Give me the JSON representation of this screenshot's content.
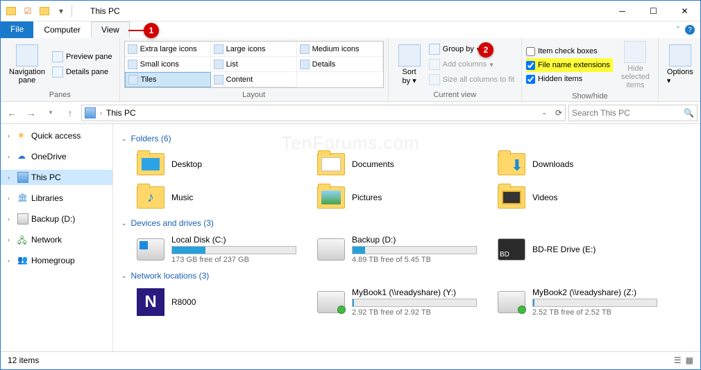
{
  "title": "This PC",
  "tabs": {
    "file": "File",
    "computer": "Computer",
    "view": "View"
  },
  "ribbon": {
    "panes": {
      "nav": "Navigation\npane",
      "preview": "Preview pane",
      "details": "Details pane",
      "group": "Panes"
    },
    "layout": {
      "extra_large": "Extra large icons",
      "large": "Large icons",
      "medium": "Medium icons",
      "small": "Small icons",
      "list": "List",
      "details": "Details",
      "tiles": "Tiles",
      "content": "Content",
      "group": "Layout"
    },
    "current": {
      "sort": "Sort\nby",
      "groupby": "Group by",
      "addcols": "Add columns",
      "sizeall": "Size all columns to fit",
      "group": "Current view"
    },
    "showhide": {
      "itemcheck": "Item check boxes",
      "fileext": "File name extensions",
      "hidden": "Hidden items",
      "hidesel": "Hide selected\nitems",
      "group": "Show/hide"
    },
    "options": "Options"
  },
  "address": {
    "path": "This PC",
    "search_placeholder": "Search This PC"
  },
  "nav": {
    "quick": "Quick access",
    "onedrive": "OneDrive",
    "thispc": "This PC",
    "libraries": "Libraries",
    "backup": "Backup (D:)",
    "network": "Network",
    "homegroup": "Homegroup"
  },
  "sections": {
    "folders": "Folders (6)",
    "drives": "Devices and drives (3)",
    "netloc": "Network locations (3)"
  },
  "folders": {
    "desktop": "Desktop",
    "documents": "Documents",
    "downloads": "Downloads",
    "music": "Music",
    "pictures": "Pictures",
    "videos": "Videos"
  },
  "drives": {
    "local": {
      "name": "Local Disk (C:)",
      "sub": "173 GB free of 237 GB",
      "fill": 27
    },
    "backup": {
      "name": "Backup (D:)",
      "sub": "4.89 TB free of 5.45 TB",
      "fill": 10
    },
    "bdre": {
      "name": "BD-RE Drive (E:)"
    }
  },
  "netloc": {
    "r8000": {
      "name": "R8000"
    },
    "mybook1": {
      "name": "MyBook1 (\\\\readyshare) (Y:)",
      "sub": "2.92 TB free of 2.92 TB",
      "fill": 1
    },
    "mybook2": {
      "name": "MyBook2 (\\\\readyshare) (Z:)",
      "sub": "2.52 TB free of 2.52 TB",
      "fill": 1
    }
  },
  "status": "12 items",
  "watermark": "TenForums.com",
  "callouts": {
    "c1": "1",
    "c2": "2"
  }
}
